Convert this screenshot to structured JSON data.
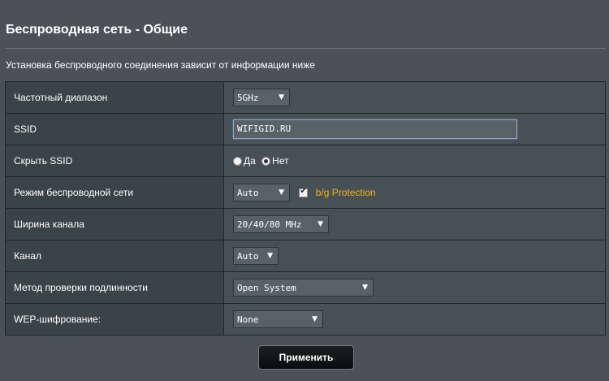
{
  "header": {
    "title": "Беспроводная сеть - Общие",
    "description": "Установка беспроводного соединения зависит от информации ниже"
  },
  "rows": {
    "band": {
      "label": "Частотный диапазон",
      "value": "5GHz"
    },
    "ssid": {
      "label": "SSID",
      "value": "WIFIGID.RU"
    },
    "hide_ssid": {
      "label": "Скрыть SSID",
      "option_yes": "Да",
      "option_no": "Нет",
      "selected": "Нет"
    },
    "wireless_mode": {
      "label": "Режим беспроводной сети",
      "value": "Auto",
      "protection_label": "b/g Protection",
      "protection_checked": true
    },
    "channel_width": {
      "label": "Ширина канала",
      "value": "20/40/80 MHz"
    },
    "channel": {
      "label": "Канал",
      "value": "Auto"
    },
    "auth_method": {
      "label": "Метод проверки подлинности",
      "value": "Open System"
    },
    "wep": {
      "label": "WEP-шифрование:",
      "value": "None"
    }
  },
  "actions": {
    "apply_label": "Применить"
  },
  "colors": {
    "background": "#4a5257",
    "accent": "#f2b21c",
    "input_focus": "#8fa9c4"
  },
  "icons": {
    "dropdown": "triangle-down-icon"
  }
}
